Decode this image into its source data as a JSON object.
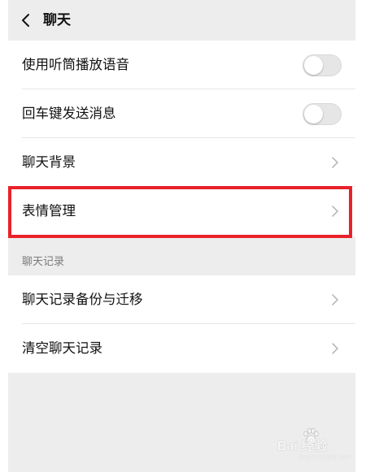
{
  "header": {
    "title": "聊天",
    "back_icon": "chevron-left-icon"
  },
  "settings": {
    "use_earpiece": {
      "label": "使用听筒播放语音",
      "enabled": false
    },
    "enter_to_send": {
      "label": "回车键发送消息",
      "enabled": false
    },
    "chat_background": {
      "label": "聊天背景"
    },
    "sticker_management": {
      "label": "表情管理",
      "highlighted": true
    }
  },
  "chat_history": {
    "section_label": "聊天记录",
    "backup_migrate": {
      "label": "聊天记录备份与迁移"
    },
    "clear_history": {
      "label": "清空聊天记录"
    }
  },
  "watermark": {
    "text": "Bai 经验",
    "sub": "jingyan.baidu.com"
  },
  "colors": {
    "background": "#ededed",
    "card": "#ffffff",
    "highlight_border": "#e8212a",
    "toggle_off": "#e6e6e6"
  }
}
